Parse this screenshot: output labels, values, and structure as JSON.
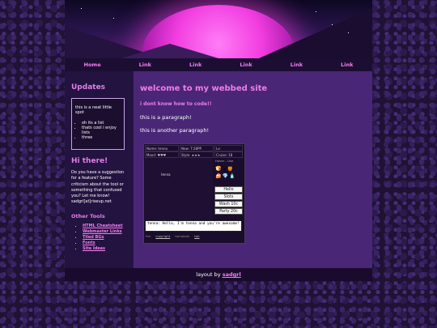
{
  "nav": [
    "Home",
    "Link",
    "Link",
    "Link",
    "Link",
    "Link"
  ],
  "sidebar": {
    "updates_title": "Updates",
    "box_text": "this is a neat little spot",
    "box_list": [
      "oh its a list",
      "thats cool i enjoy lists",
      "three"
    ],
    "hi_title": "Hi there!",
    "hi_text": "Do you have a suggestion for a feature? Some criticism about the tool or something that confused you? Let me know! sadgrl[at]riseup.net",
    "other_title": "Other Tools",
    "links": [
      "HTML Cheatsheet",
      "Webmaster Links",
      "Tiled BGs",
      "Fonts",
      "Site Ideas"
    ]
  },
  "main": {
    "title": "welcome to my webbed site",
    "subtitle": "i dont know how to code!!",
    "para1": "this is a paragraph!",
    "para2": "this is another paragraph!"
  },
  "game": {
    "stats": [
      "Name: tenna",
      "Now: 7:28PP",
      "Lv:",
      "Mood: ♥♥♥",
      "Style: ★★★",
      "Cruise: 18"
    ],
    "character": "tenna",
    "inventory_label": "Hover - Use",
    "buttons": [
      "Hello",
      "Slots",
      "Wash 10c",
      "Party 20c"
    ],
    "dialog": "tenna: Hello, I'm tenna and you're awesome!",
    "footer": [
      "the",
      "copyright",
      "tamabots",
      "tab"
    ]
  },
  "footer": {
    "text": "layout by",
    "link": "sadgrl"
  }
}
